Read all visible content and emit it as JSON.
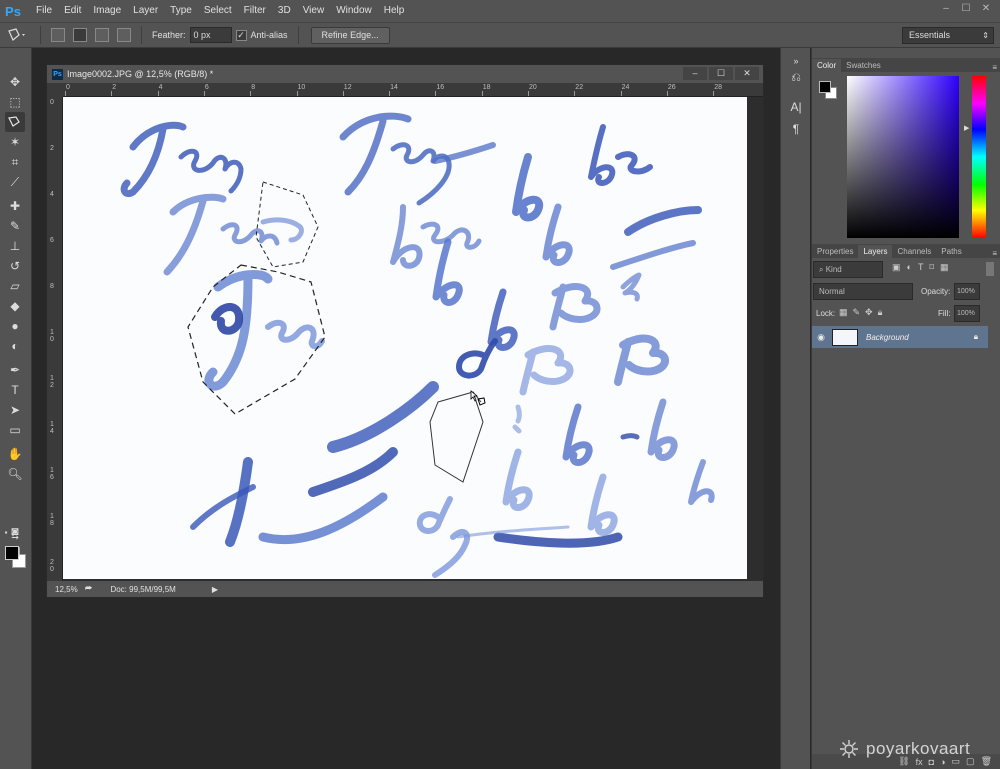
{
  "app": {
    "logo": "Ps",
    "menu": [
      "File",
      "Edit",
      "Image",
      "Layer",
      "Type",
      "Select",
      "Filter",
      "3D",
      "View",
      "Window",
      "Help"
    ]
  },
  "window_controls": {
    "minimize": "–",
    "restore": "☐",
    "close": "✕"
  },
  "options_bar": {
    "feather_label": "Feather:",
    "feather_value": "0 px",
    "antialias_label": "Anti-alias",
    "antialias_checked": true,
    "refine_edge_label": "Refine Edge...",
    "workspace": "Essentials"
  },
  "document": {
    "title": "Image0002.JPG @ 12,5% (RGB/8) *",
    "ruler_h": [
      "0",
      "2",
      "4",
      "6",
      "8",
      "10",
      "12",
      "14",
      "16",
      "18",
      "20",
      "22",
      "24",
      "26",
      "28"
    ],
    "ruler_v": [
      "0",
      "2",
      "4",
      "6",
      "8",
      "1 0",
      "1 2",
      "1 4",
      "1 6",
      "1 8",
      "2 0"
    ],
    "status_zoom": "12,5%",
    "status_info": "Doc: 99,5M/99,5M"
  },
  "color_panel": {
    "tabs": [
      "Color",
      "Swatches"
    ],
    "active_tab": "Color",
    "foreground": "#000000",
    "background": "#ffffff"
  },
  "layers_panel": {
    "tabs": [
      "Properties",
      "Layers",
      "Channels",
      "Paths"
    ],
    "active_tab": "Layers",
    "kind_filter": "Kind",
    "blend_mode": "Normal",
    "opacity_label": "Opacity:",
    "opacity_value": "100%",
    "lock_label": "Lock:",
    "fill_label": "Fill:",
    "fill_value": "100%",
    "layers": [
      {
        "name": "Background",
        "visible": true,
        "locked": true,
        "selected": true
      }
    ]
  },
  "watermark": "poyarkovaart",
  "colors": {
    "ink": "#3f5fb8",
    "panel": "#535353",
    "selected_layer": "#5f748f"
  }
}
